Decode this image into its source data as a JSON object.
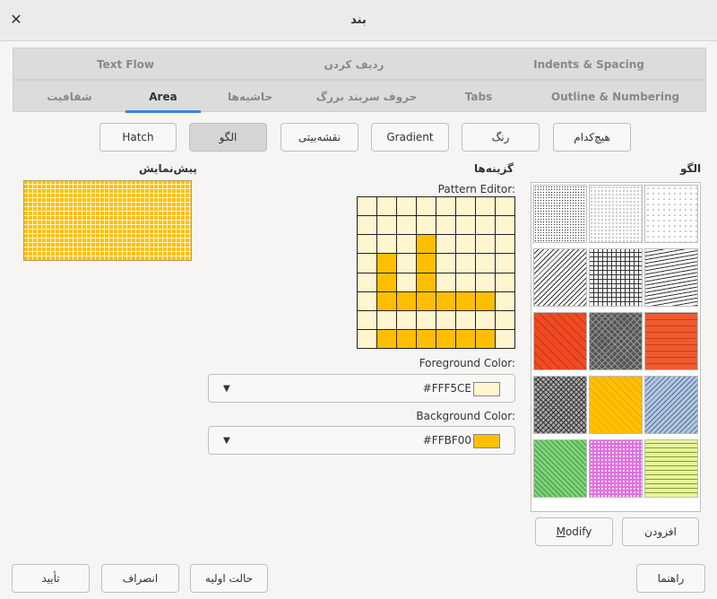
{
  "window": {
    "title": "بند",
    "close_icon": "close-icon"
  },
  "tabs_row1": [
    {
      "label": "Text Flow"
    },
    {
      "label": "ردیف کردن"
    },
    {
      "label": "Indents & Spacing"
    }
  ],
  "tabs_row2": [
    {
      "label": "شفافیت"
    },
    {
      "label": "Area",
      "active": true
    },
    {
      "label": "حاشیه‌ها"
    },
    {
      "label": "حروف سربند بزرگ"
    },
    {
      "label": "Tabs"
    },
    {
      "label": "Outline & Numbering"
    }
  ],
  "fill_types": [
    {
      "label": "Hatch"
    },
    {
      "label": "الگو",
      "selected": true
    },
    {
      "label": "نقشه‌بیتی"
    },
    {
      "label": "Gradient"
    },
    {
      "label": "رنگ"
    },
    {
      "label": "هیچ‌کدام"
    }
  ],
  "sections": {
    "preview": "پیش‌نمایش",
    "options": "گزینه‌ها",
    "pattern": "الگو"
  },
  "pattern_editor": {
    "label": "Pattern Editor:"
  },
  "foreground": {
    "label": "Foreground Color:",
    "value": "#FFF5CE",
    "color": "#FFF5CE"
  },
  "background": {
    "label": "Background Color:",
    "value": "#FFBF00",
    "color": "#FFBF00"
  },
  "pattern_buttons": {
    "modify": "Modify",
    "add": "افزودن"
  },
  "footer": {
    "ok": "تأیید",
    "cancel": "انصراف",
    "reset": "حالت اولیه",
    "help": "راهنما"
  }
}
